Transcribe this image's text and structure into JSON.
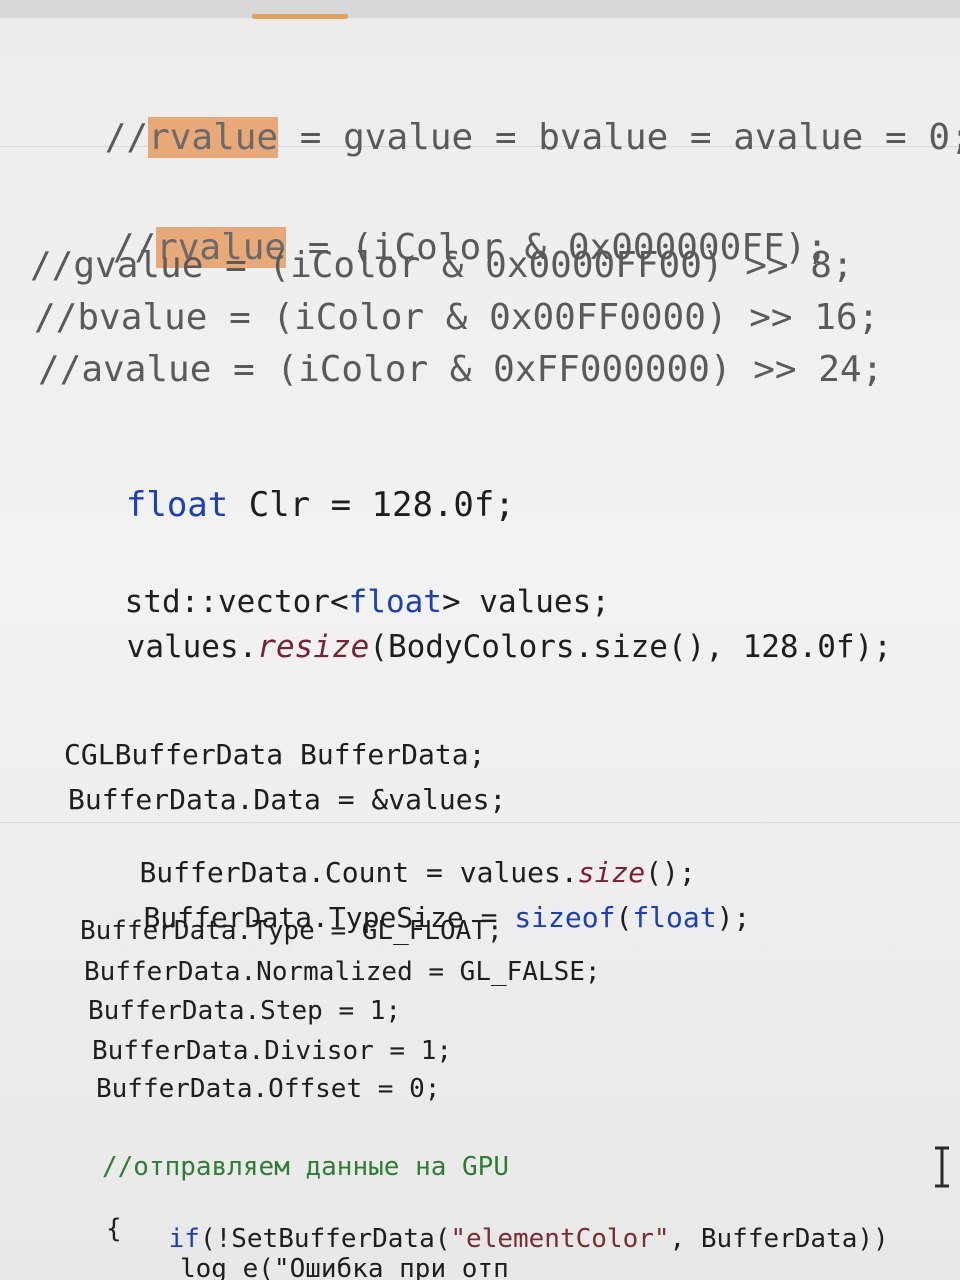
{
  "editor": {
    "lines": [
      {
        "p1": "//",
        "hl": "rvalue",
        "p2": " = gvalue = bvalue = avalue = 0;"
      },
      {
        "p1": "//",
        "hl": "rvalue",
        "p2": " = (iColor & 0x000000FF);"
      },
      {
        "text": "//gvalue = (iColor & 0x0000FF00) >> 8;"
      },
      {
        "text": "//bvalue = (iColor & 0x00FF0000) >> 16;"
      },
      {
        "text": "//avalue = (iColor & 0xFF000000) >> 24;"
      },
      {
        "kw": "float",
        "rest": " Clr = 128.0f;"
      },
      {
        "a": "std::vector<",
        "kw": "float",
        "b": "> values;"
      },
      {
        "a": "values.",
        "fn": "resize",
        "b": "(BodyColors.size(), 128.0f);"
      },
      {
        "text": "CGLBufferData BufferData;"
      },
      {
        "text": "BufferData.Data = &values;"
      },
      {
        "a": "BufferData.Count = values.",
        "fn": "size",
        "b": "();"
      },
      {
        "a": "BufferData.TypeSize = ",
        "kw1": "sizeof",
        "m": "(",
        "kw2": "float",
        "b": ");"
      },
      {
        "text": "BufferData.Type = GL_FLOAT;"
      },
      {
        "text": "BufferData.Normalized = GL_FALSE;"
      },
      {
        "text": "BufferData.Step = 1;"
      },
      {
        "text": "BufferData.Divisor = 1;"
      },
      {
        "text": "BufferData.Offset = 0;"
      },
      {
        "text": "//отправляем данные на GPU"
      },
      {
        "kw": "if",
        "a": "(!SetBufferData(",
        "str": "\"elementColor\"",
        "b": ", BufferData))"
      },
      {
        "text": "{"
      },
      {
        "text": "log_e(\"Ошибка при отп"
      }
    ]
  }
}
